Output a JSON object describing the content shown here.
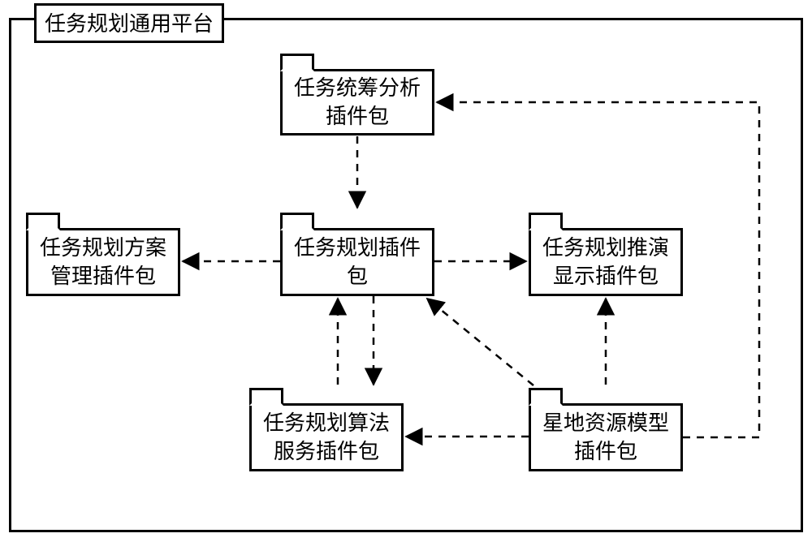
{
  "diagram": {
    "title": "任务规划通用平台",
    "packages": {
      "analysis": {
        "label": "任务统筹分析\n插件包"
      },
      "planMgmt": {
        "label": "任务规划方案\n管理插件包"
      },
      "planning": {
        "label": "任务规划插件\n包"
      },
      "simDisplay": {
        "label": "任务规划推演\n显示插件包"
      },
      "algoSvc": {
        "label": "任务规划算法\n服务插件包"
      },
      "resModel": {
        "label": "星地资源模型\n插件包"
      }
    }
  }
}
